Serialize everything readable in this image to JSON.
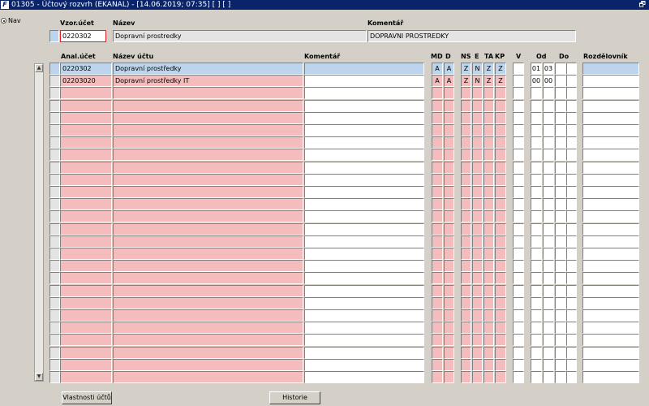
{
  "window": {
    "app_icon": "F",
    "title": "01305 - Účtový rozvrh (EKANAL) - [14.06.2019; 07:35] [ ] [ ]",
    "restore_glyph": "🗗"
  },
  "side": {
    "nav_label": "Nav"
  },
  "header": {
    "labels": {
      "vzor_ucet": "Vzor.účet",
      "nazev": "Název",
      "komentar": "Komentář"
    },
    "values": {
      "vzor_ucet": "0220302",
      "nazev": "Dopravní prostredky",
      "komentar": "DOPRAVNI PROSTREDKY"
    }
  },
  "grid": {
    "columns": {
      "anal_ucet": "Anal.účet",
      "nazev_uctu": "Název účtu",
      "komentar": "Komentář",
      "md": "MD",
      "d": "D",
      "ns": "NS",
      "e": "E",
      "ta": "TA",
      "kp": "KP",
      "v": "V",
      "od": "Od",
      "do": "Do",
      "rozdelovnik": "Rozdělovník"
    },
    "rows": [
      {
        "anal_ucet": "0220302",
        "nazev_uctu": "Dopravní prostředky",
        "komentar": "",
        "md": "A",
        "d": "A",
        "ns": "Z",
        "e": "N",
        "ta": "Z",
        "kp": "Z",
        "v": "",
        "od1": "01",
        "od2": "03",
        "do": "",
        "rozdelovnik": ""
      },
      {
        "anal_ucet": "02203020",
        "nazev_uctu": "Dopravní prostředky IT",
        "komentar": "",
        "md": "A",
        "d": "A",
        "ns": "Z",
        "e": "N",
        "ta": "Z",
        "kp": "Z",
        "v": "",
        "od1": "00",
        "od2": "00",
        "do": "",
        "rozdelovnik": ""
      }
    ],
    "empty_row_count": 24
  },
  "buttons": {
    "vlastnosti": "Vlastnosti účtů",
    "historie": "Historie"
  },
  "colors": {
    "title_bg": "#0a246a",
    "selected_row": "#bcd4ec",
    "required_field": "#f4bcbc",
    "window_bg": "#d4d0c8"
  }
}
